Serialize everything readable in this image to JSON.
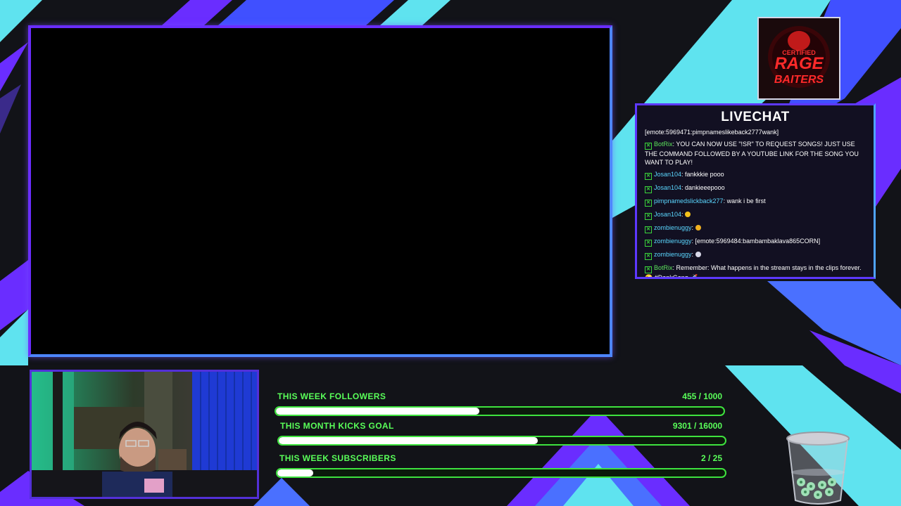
{
  "logo": {
    "line1": "CERTIFIED",
    "line2": "RAGE",
    "line3": "BAITERS"
  },
  "chat": {
    "title": "LIVECHAT",
    "messages": [
      {
        "user": "",
        "text": "[emote:5969471:pimpnameslikeback2777wank]",
        "badge": false
      },
      {
        "user": "BotRix",
        "text": ": YOU CAN NOW USE \"!SR\" TO REQUEST SONGS! JUST USE THE COMMAND FOLLOWED BY A YOUTUBE LINK FOR THE SONG YOU WANT TO PLAY!",
        "badge": true
      },
      {
        "user": "Josan104",
        "text": ": fankkkie pooo",
        "badge": true
      },
      {
        "user": "Josan104",
        "text": ": dankieeepooo",
        "badge": true
      },
      {
        "user": "pimpnamedslickback277",
        "text": ": wank i be first",
        "badge": true
      },
      {
        "user": "Josan104",
        "text": ":",
        "badge": true,
        "emote": "#f4c21a"
      },
      {
        "user": "zombienuggy",
        "text": ":",
        "badge": true,
        "emote": "#f0b020"
      },
      {
        "user": "zombienuggy",
        "text": ": [emote:5969484:bambambaklava865CORN]",
        "badge": true
      },
      {
        "user": "zombienuggy",
        "text": ":",
        "badge": true,
        "emote": "#d8d8e8"
      },
      {
        "user": "BotRix",
        "text": ": Remember: What happens in the stream stays in the clips forever. 😜 #DankGang 🚀",
        "badge": true
      }
    ]
  },
  "goals": [
    {
      "label": "THIS WEEK FOLLOWERS",
      "value": "455 / 1000",
      "progress": 0.455
    },
    {
      "label": "THIS MONTH KICKS GOAL",
      "value": "9301 / 16000",
      "progress": 0.581
    },
    {
      "label": "THIS WEEK SUBSCRIBERS",
      "value": "2 / 25",
      "progress": 0.08
    }
  ],
  "colors": {
    "accent_purple": "#6a2dff",
    "accent_cyan": "#5fe3ef",
    "goal_green": "#3ee33e"
  }
}
